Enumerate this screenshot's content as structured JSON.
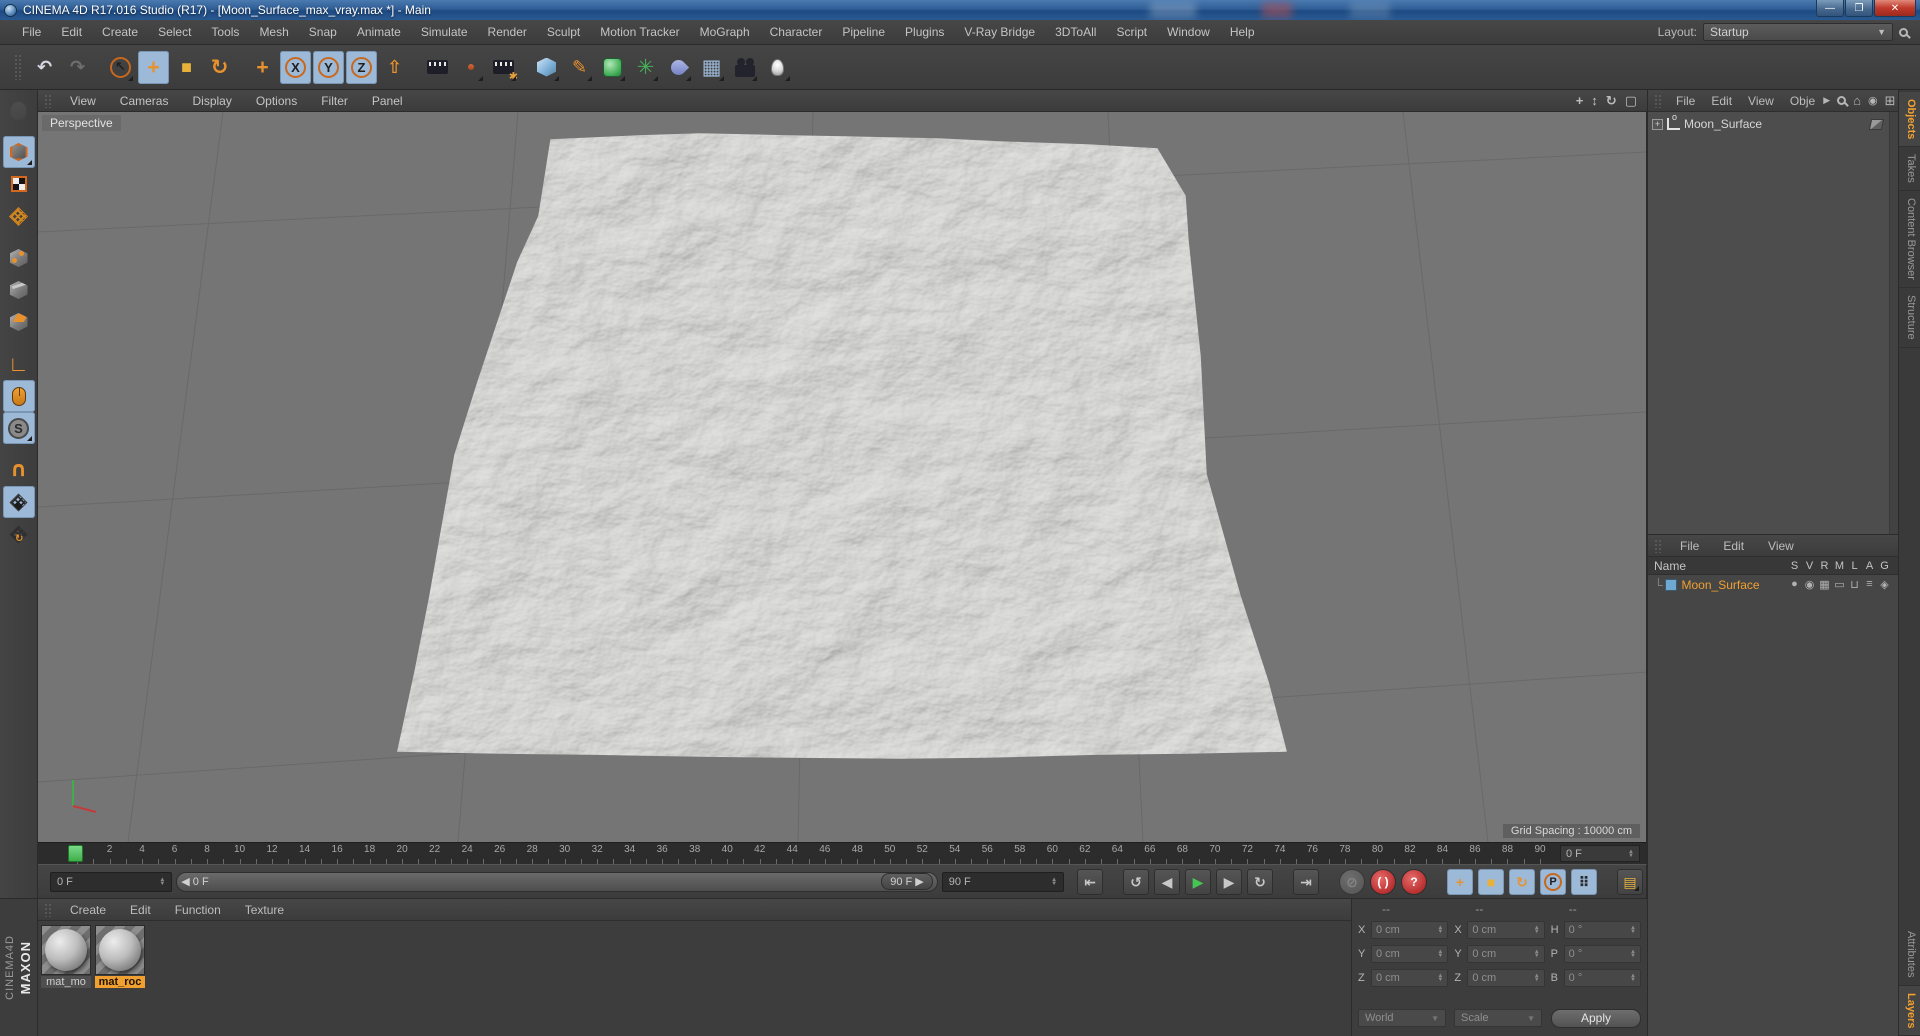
{
  "window": {
    "title": "CINEMA 4D R17.016 Studio (R17) - [Moon_Surface_max_vray.max *] - Main",
    "minimize_glyph": "—",
    "maximize_glyph": "❐",
    "close_glyph": "✕"
  },
  "menu_bar": {
    "items": [
      "File",
      "Edit",
      "Create",
      "Select",
      "Tools",
      "Mesh",
      "Snap",
      "Animate",
      "Simulate",
      "Render",
      "Sculpt",
      "Motion Tracker",
      "MoGraph",
      "Character",
      "Pipeline",
      "Plugins",
      "V-Ray Bridge",
      "3DToAll",
      "Script",
      "Window",
      "Help"
    ],
    "layout_label": "Layout:",
    "layout_value": "Startup"
  },
  "main_toolbar": {
    "buttons": [
      {
        "name": "undo-button",
        "icon": "undo-icon",
        "glyph": "↶",
        "color": "#d8d8e4"
      },
      {
        "name": "redo-button",
        "icon": "redo-icon",
        "glyph": "↷",
        "color": "#d8d8e4",
        "disabled": true
      },
      {
        "sep": true
      },
      {
        "name": "live-selection-button",
        "icon": "selection-arrow-icon",
        "glyph": "↖",
        "ring": true,
        "fly": true
      },
      {
        "name": "move-tool-button",
        "icon": "move-icon",
        "glyph": "+",
        "color": "#e8912d",
        "active": true,
        "big": true
      },
      {
        "name": "scale-tool-button",
        "icon": "scale-icon",
        "glyph": "■",
        "color": "#e8b23a"
      },
      {
        "name": "rotate-tool-button",
        "icon": "rotate-icon",
        "glyph": "↻",
        "color": "#e8912d",
        "big": true
      },
      {
        "sep": true
      },
      {
        "name": "last-tool-button",
        "icon": "move-cross-icon",
        "glyph": "+",
        "color": "#e8912d",
        "big": true
      },
      {
        "name": "x-axis-lock-button",
        "icon": "x-axis-icon",
        "glyph": "X",
        "ring": true,
        "active": true
      },
      {
        "name": "y-axis-lock-button",
        "icon": "y-axis-icon",
        "glyph": "Y",
        "ring": true,
        "active": true
      },
      {
        "name": "z-axis-lock-button",
        "icon": "z-axis-icon",
        "glyph": "Z",
        "ring": true,
        "active": true
      },
      {
        "name": "coordinate-system-button",
        "icon": "coord-system-icon",
        "glyph": "⇧",
        "color": "#e8912d"
      },
      {
        "sep": true
      },
      {
        "name": "render-view-button",
        "icon": "render-clapper-icon",
        "shape": "icon-clapper"
      },
      {
        "name": "render-picture-viewer-button",
        "icon": "render-picture-icon",
        "shape": "icon-clapper",
        "redpad": true,
        "fly": true
      },
      {
        "name": "render-settings-button",
        "icon": "render-settings-icon",
        "shape": "icon-clapper",
        "gear": "✱",
        "fly": true
      },
      {
        "sep": true
      },
      {
        "name": "add-primitive-button",
        "icon": "cube-icon",
        "shape": "icon-cube",
        "fly": true
      },
      {
        "name": "add-spline-button",
        "icon": "pen-icon",
        "glyph": "✎",
        "color": "#e8912d",
        "fly": true
      },
      {
        "name": "add-generator-button",
        "icon": "generator-sphere-icon",
        "shape": "icon-gen",
        "fly": true
      },
      {
        "name": "add-mograph-button",
        "icon": "mograph-icon",
        "glyph": "✳",
        "color": "#46b05a",
        "big": true,
        "fly": true
      },
      {
        "name": "add-deformer-button",
        "icon": "deformer-shell-icon",
        "shape": "icon-shell",
        "fly": true
      },
      {
        "name": "add-environment-button",
        "icon": "floor-grid-icon",
        "glyph": "▦",
        "color": "#9db9d8",
        "big": true,
        "fly": true
      },
      {
        "name": "add-camera-button",
        "icon": "camera-icon",
        "shape": "icon-cam",
        "fly": true
      },
      {
        "name": "add-light-button",
        "icon": "light-bulb-icon",
        "shape": "icon-bulb",
        "fly": true
      }
    ]
  },
  "left_toolbar": {
    "buttons": [
      {
        "name": "make-editable-button",
        "icon": "editable-head-icon",
        "shape": "icon-head",
        "disabled": true
      },
      {
        "name": "model-mode-button",
        "icon": "model-cube-icon",
        "shape": "icon-cube-outline",
        "active": true,
        "gap": true,
        "fly": true
      },
      {
        "name": "texture-mode-button",
        "icon": "texture-checker-icon",
        "shape": "icon-checker"
      },
      {
        "name": "workplane-mode-button",
        "icon": "workplane-grid-icon",
        "shape": "icon-grid-orange"
      },
      {
        "name": "points-mode-button",
        "icon": "point-cube-icon",
        "shape": "icon-cube-gray",
        "ovl": "dots",
        "gap": true
      },
      {
        "name": "edges-mode-button",
        "icon": "edge-cube-icon",
        "shape": "icon-cube-gray",
        "ovl": "edge"
      },
      {
        "name": "polygons-mode-button",
        "icon": "polygon-cube-icon",
        "shape": "icon-cube-gray",
        "ovl": "face"
      },
      {
        "name": "enable-axis-button",
        "icon": "axis-angle-icon",
        "glyph": "∟",
        "color": "#e8912d",
        "big": true,
        "gap": true
      },
      {
        "name": "mouse-input-button",
        "icon": "mouse-icon",
        "shape": "icon-mouse",
        "active": true
      },
      {
        "name": "snap-enable-button",
        "icon": "snap-s-icon",
        "glyph": "S",
        "ringdark": true,
        "active": true,
        "fly": true
      },
      {
        "name": "magnet-snap-button",
        "icon": "magnet-icon",
        "glyph": "∪",
        "color": "#e8912d",
        "big": true,
        "rot": true,
        "gap": true
      },
      {
        "name": "workplane-lock-button",
        "icon": "workplane-lock-icon",
        "shape": "icon-grid-gray",
        "ovl": "lock",
        "active": true
      },
      {
        "name": "workplane-rotate-button",
        "icon": "workplane-rotate-icon",
        "shape": "icon-grid-gray",
        "ovl": "rot"
      }
    ]
  },
  "viewport": {
    "menu": [
      "View",
      "Cameras",
      "Display",
      "Options",
      "Filter",
      "Panel"
    ],
    "label": "Perspective",
    "status": "Grid Spacing : 10000 cm",
    "nav_icons": [
      {
        "name": "pan-view-icon",
        "glyph": "+"
      },
      {
        "name": "zoom-view-icon",
        "glyph": "↕"
      },
      {
        "name": "rotate-view-icon",
        "glyph": "↻"
      },
      {
        "name": "maximize-view-icon",
        "glyph": "▢"
      }
    ]
  },
  "timeline": {
    "ruler": {
      "start": 0,
      "end": 90,
      "step": 2,
      "current": 0
    },
    "ruler_right_field": "0 F",
    "current_field": "0 F",
    "slider_start_label": "◀ 0 F",
    "slider_end_label": "90 F ▶",
    "end_field": "90 F",
    "transport": [
      {
        "name": "goto-start-button",
        "icon": "goto-start-icon",
        "glyph": "⇤"
      },
      {
        "name": "previous-key-button",
        "icon": "previous-key-icon",
        "glyph": "↺",
        "gapbefore": true
      },
      {
        "name": "previous-frame-button",
        "icon": "previous-frame-icon",
        "glyph": "◀"
      },
      {
        "name": "play-button",
        "icon": "play-icon",
        "glyph": "▶",
        "color": "#46c454"
      },
      {
        "name": "next-frame-button",
        "icon": "next-frame-icon",
        "glyph": "▶"
      },
      {
        "name": "next-key-button",
        "icon": "next-key-icon",
        "glyph": "↻"
      },
      {
        "name": "goto-end-button",
        "icon": "goto-end-icon",
        "glyph": "⇥",
        "gapbefore": true
      },
      {
        "name": "record-objects-button",
        "icon": "record-icon",
        "glyph": "⊘",
        "circle": "gray",
        "gapbefore": true
      },
      {
        "name": "autokeying-button",
        "icon": "autokey-icon",
        "glyph": "( )",
        "circle": "red"
      },
      {
        "name": "keyframe-selection-button",
        "icon": "keyframe-question-icon",
        "glyph": "?",
        "circle": "red"
      },
      {
        "name": "key-position-button",
        "icon": "key-position-icon",
        "glyph": "+",
        "color": "#e8912d",
        "blue": true,
        "gapbefore": true
      },
      {
        "name": "key-scale-button",
        "icon": "key-scale-icon",
        "glyph": "■",
        "color": "#e8b23a",
        "blue": true
      },
      {
        "name": "key-rotation-button",
        "icon": "key-rotation-icon",
        "glyph": "↻",
        "color": "#e8912d",
        "blue": true
      },
      {
        "name": "key-parameter-button",
        "icon": "key-parameter-icon",
        "glyph": "P",
        "ring": true,
        "blue": true
      },
      {
        "name": "key-pla-button",
        "icon": "key-pla-icon",
        "glyph": "⠿",
        "color": "#2b2b2b",
        "blue": true
      },
      {
        "name": "keyframe-presets-button",
        "icon": "keyframe-film-icon",
        "glyph": "▤",
        "color": "#e8b23a",
        "gapbefore": true,
        "fly": true
      }
    ]
  },
  "materials": {
    "menu": [
      "Create",
      "Edit",
      "Function",
      "Texture"
    ],
    "items": [
      {
        "name": "mat_mo",
        "selected": false
      },
      {
        "name": "mat_roc",
        "selected": true
      }
    ]
  },
  "coordinates": {
    "headers": [
      "--",
      "--",
      "--"
    ],
    "groups": [
      {
        "rows": [
          {
            "label": "X",
            "value": "0 cm"
          },
          {
            "label": "Y",
            "value": "0 cm"
          },
          {
            "label": "Z",
            "value": "0 cm"
          }
        ]
      },
      {
        "rows": [
          {
            "label": "X",
            "value": "0 cm"
          },
          {
            "label": "Y",
            "value": "0 cm"
          },
          {
            "label": "Z",
            "value": "0 cm"
          }
        ]
      },
      {
        "rows": [
          {
            "label": "H",
            "value": "0 °"
          },
          {
            "label": "P",
            "value": "0 °"
          },
          {
            "label": "B",
            "value": "0 °"
          }
        ]
      }
    ],
    "combo_world": "World",
    "combo_scale": "Scale",
    "apply_label": "Apply"
  },
  "object_manager": {
    "menu": [
      "File",
      "Edit",
      "View",
      "Obje"
    ],
    "object_name": "Moon_Surface"
  },
  "layer_manager": {
    "menu": [
      "File",
      "Edit",
      "View"
    ],
    "name_column": "Name",
    "columns": [
      "S",
      "V",
      "R",
      "M",
      "L",
      "A",
      "G"
    ],
    "row_icons": [
      "●",
      "◉",
      "▦",
      "▭",
      "⊔",
      "≡",
      "◈"
    ],
    "rows": [
      {
        "name": "Moon_Surface"
      }
    ]
  },
  "side_tabs": {
    "top": [
      {
        "label": "Objects",
        "active": true
      },
      {
        "label": "Takes",
        "active": false
      },
      {
        "label": "Content Browser",
        "active": false
      },
      {
        "label": "Structure",
        "active": false
      }
    ],
    "bottom": [
      {
        "label": "Attributes",
        "active": false
      },
      {
        "label": "Layers",
        "active": true
      }
    ]
  },
  "branding": {
    "line1": "MAXON",
    "line2": "CINEMA4D"
  },
  "colors": {
    "accent_orange": "#f0a030",
    "active_blue": "#9db9d8",
    "play_green": "#3fae4a",
    "record_red": "#c43b3b",
    "viewport_gray": "#757575"
  }
}
